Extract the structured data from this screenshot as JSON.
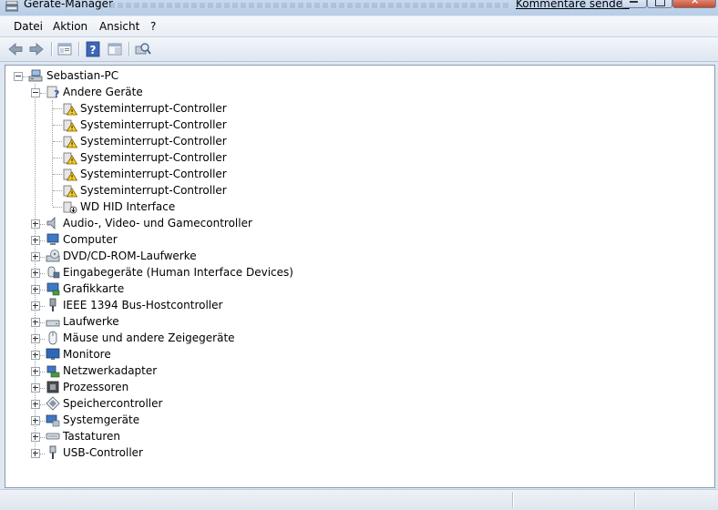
{
  "window": {
    "title": "Geräte-Manager",
    "feedback_link": "Kommentare senden"
  },
  "menu": {
    "items": [
      "Datei",
      "Aktion",
      "Ansicht",
      "?"
    ]
  },
  "toolbar": {
    "icons": [
      "back-arrow-icon",
      "forward-arrow-icon",
      "properties-icon",
      "help-icon",
      "view-icon",
      "scan-hardware-icon"
    ]
  },
  "tree": {
    "root": {
      "label": "Sebastian-PC",
      "icon": "computer-icon"
    },
    "other_devices": {
      "label": "Andere Geräte",
      "icon": "unknown-device-icon",
      "children": [
        {
          "label": "Systeminterrupt-Controller",
          "icon": "warning-device-icon"
        },
        {
          "label": "Systeminterrupt-Controller",
          "icon": "warning-device-icon"
        },
        {
          "label": "Systeminterrupt-Controller",
          "icon": "warning-device-icon"
        },
        {
          "label": "Systeminterrupt-Controller",
          "icon": "warning-device-icon"
        },
        {
          "label": "Systeminterrupt-Controller",
          "icon": "warning-device-icon"
        },
        {
          "label": "Systeminterrupt-Controller",
          "icon": "warning-device-icon"
        },
        {
          "label": "WD HID Interface",
          "icon": "disabled-device-icon"
        }
      ]
    },
    "categories": [
      {
        "label": "Audio-, Video- und Gamecontroller",
        "icon": "speaker-icon"
      },
      {
        "label": "Computer",
        "icon": "computer-icon"
      },
      {
        "label": "DVD/CD-ROM-Laufwerke",
        "icon": "optical-drive-icon"
      },
      {
        "label": "Eingabegeräte (Human Interface Devices)",
        "icon": "hid-icon"
      },
      {
        "label": "Grafikkarte",
        "icon": "display-adapter-icon"
      },
      {
        "label": "IEEE 1394 Bus-Hostcontroller",
        "icon": "firewire-icon"
      },
      {
        "label": "Laufwerke",
        "icon": "disk-drive-icon"
      },
      {
        "label": "Mäuse und andere Zeigegeräte",
        "icon": "mouse-icon"
      },
      {
        "label": "Monitore",
        "icon": "monitor-icon"
      },
      {
        "label": "Netzwerkadapter",
        "icon": "network-adapter-icon"
      },
      {
        "label": "Prozessoren",
        "icon": "processor-icon"
      },
      {
        "label": "Speichercontroller",
        "icon": "storage-controller-icon"
      },
      {
        "label": "Systemgeräte",
        "icon": "system-devices-icon"
      },
      {
        "label": "Tastaturen",
        "icon": "keyboard-icon"
      },
      {
        "label": "USB-Controller",
        "icon": "usb-icon"
      }
    ]
  }
}
